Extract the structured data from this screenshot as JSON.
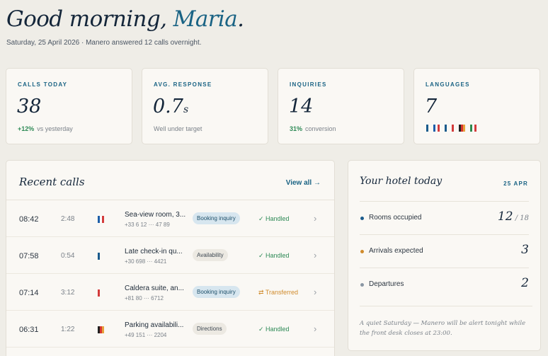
{
  "header": {
    "greeting_prefix": "Good morning, ",
    "user_name": "Maria",
    "greeting_suffix": ".",
    "subline": "Saturday, 25 April 2026 · Manero answered 12 calls overnight."
  },
  "stats": [
    {
      "label": "CALLS TODAY",
      "value": "38",
      "unit": "",
      "delta": "+12%",
      "note": "vs yesterday"
    },
    {
      "label": "AVG. RESPONSE",
      "value": "0.7",
      "unit": "s",
      "delta": "",
      "note": "Well under target"
    },
    {
      "label": "INQUIRIES",
      "value": "14",
      "unit": "",
      "delta": "31%",
      "note": "conversion"
    },
    {
      "label": "LANGUAGES",
      "value": "7",
      "unit": "",
      "delta": "",
      "note": ""
    }
  ],
  "colors": {
    "accent": "#1a6384",
    "positive": "#2e8a56",
    "warning": "#d08b2c"
  },
  "language_flags": [
    [
      "#1a5b8c"
    ],
    [
      "#1e5fa8",
      "#ffffff",
      "#d33b3b"
    ],
    [
      "#1a5b8c"
    ],
    [
      "#d33b3b"
    ],
    [
      "#222222",
      "#d9352f",
      "#e6a23c"
    ],
    [
      "#2d8a4e",
      "#ffffff",
      "#d33b3b"
    ]
  ],
  "recent_calls": {
    "title": "Recent calls",
    "view_all": "View all →",
    "rows": [
      {
        "time": "08:42",
        "duration": "2:48",
        "flag": [
          "#1e5fa8",
          "#ffffff",
          "#d33b3b"
        ],
        "topic": "Sea-view room, 3...",
        "phone": "+33 6 12 ··· 47 89",
        "tag": "Booking inquiry",
        "tag_kind": "booking",
        "status": "✓ Handled",
        "status_kind": "ok"
      },
      {
        "time": "07:58",
        "duration": "0:54",
        "flag": [
          "#1a5b8c"
        ],
        "topic": "Late check-in qu...",
        "phone": "+30 698 ··· 4421",
        "tag": "Availability",
        "tag_kind": "neutral",
        "status": "✓ Handled",
        "status_kind": "ok"
      },
      {
        "time": "07:14",
        "duration": "3:12",
        "flag": [
          "#d33b3b"
        ],
        "topic": "Caldera suite, an...",
        "phone": "+81 80 ··· 6712",
        "tag": "Booking inquiry",
        "tag_kind": "booking",
        "status": "⇄ Transferred",
        "status_kind": "warn"
      },
      {
        "time": "06:31",
        "duration": "1:22",
        "flag": [
          "#222222",
          "#d9352f",
          "#e6a23c"
        ],
        "topic": "Parking availabili...",
        "phone": "+49 151 ··· 2204",
        "tag": "Directions",
        "tag_kind": "neutral",
        "status": "✓ Handled",
        "status_kind": "ok"
      }
    ]
  },
  "hotel_today": {
    "title": "Your hotel today",
    "date": "25 APR",
    "rows": [
      {
        "label": "Rooms occupied",
        "value": "12",
        "of": " / 18",
        "dot": "#1a5b8c"
      },
      {
        "label": "Arrivals expected",
        "value": "3",
        "of": "",
        "dot": "#d08b2c"
      },
      {
        "label": "Departures",
        "value": "2",
        "of": "",
        "dot": "#8a96a3"
      }
    ],
    "note": "A quiet Saturday — Manero will be alert tonight while the front desk closes at 23:00."
  }
}
